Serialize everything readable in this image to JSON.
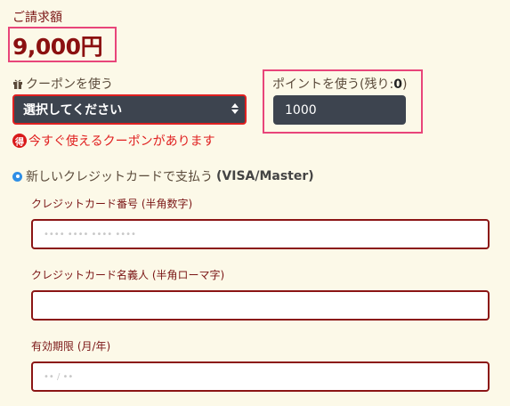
{
  "billing": {
    "label": "ご請求額",
    "amount": "9,000円"
  },
  "coupon": {
    "label": "クーポンを使う",
    "icon": "gift-icon",
    "select_value": "選択してください",
    "notice_badge": "得",
    "notice_text": "今すぐ使えるクーポンがあります"
  },
  "points": {
    "label_prefix": "ポイントを使う(残り:",
    "remaining": "0",
    "label_suffix": ")",
    "value": "1000"
  },
  "payment": {
    "option_text": "新しいクレジットカードで支払う",
    "option_brands": "(VISA/Master)",
    "card_number": {
      "label": "クレジットカード番号 (半角数字)",
      "placeholder": "•••• •••• •••• ••••"
    },
    "card_name": {
      "label": "クレジットカード名義人 (半角ローマ字)",
      "placeholder": ""
    },
    "expiry": {
      "label": "有効期限 (月/年)",
      "placeholder": "•• / ••"
    }
  },
  "colors": {
    "background": "#fcf9e8",
    "highlight_border": "#e8457a",
    "accent_red": "#e02020",
    "dark_field": "#3d444f",
    "field_border": "#8b1515"
  }
}
